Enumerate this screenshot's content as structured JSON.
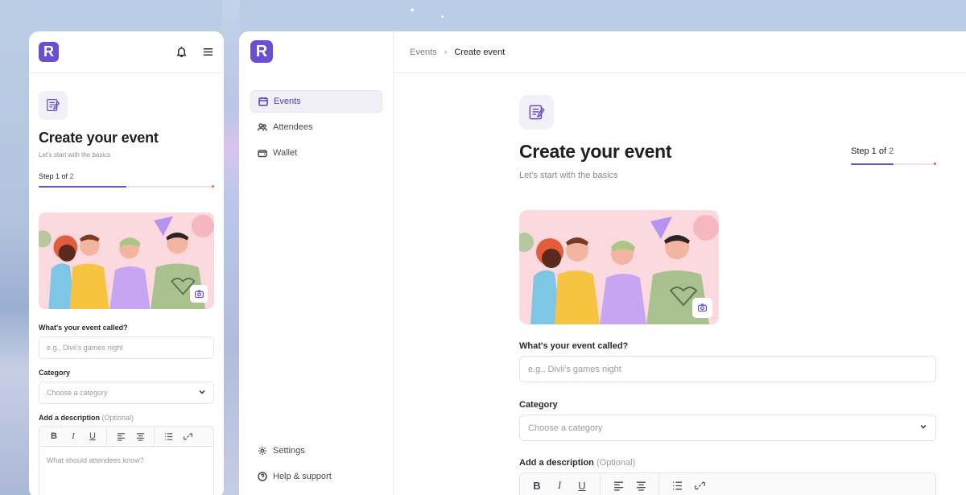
{
  "brand": {
    "logo_letter": "R",
    "accent": "#6b4fd1"
  },
  "mobile": {
    "header_icons": [
      "bell-icon",
      "menu-icon"
    ],
    "title": "Create your event",
    "subtitle": "Let's start with the basics",
    "step_prefix": "Step 1 of",
    "step_total": "2",
    "progress_fraction": 0.5,
    "event_name_label": "What's your event called?",
    "event_name_placeholder": "e.g., Divii's games night",
    "category_label": "Category",
    "category_placeholder": "Choose a category",
    "description_label": "Add a description",
    "description_optional": "(Optional)",
    "description_placeholder": "What should attendees know?"
  },
  "sidebar": {
    "items": [
      {
        "label": "Events",
        "icon": "calendar-icon",
        "active": true
      },
      {
        "label": "Attendees",
        "icon": "users-icon",
        "active": false
      },
      {
        "label": "Wallet",
        "icon": "wallet-icon",
        "active": false
      }
    ],
    "bottom_items": [
      {
        "label": "Settings",
        "icon": "gear-icon"
      },
      {
        "label": "Help & support",
        "icon": "help-icon"
      }
    ]
  },
  "breadcrumb": {
    "parent": "Events",
    "separator": "›",
    "current": "Create event"
  },
  "desktop": {
    "title": "Create your event",
    "subtitle": "Let's start with the basics",
    "step_prefix": "Step 1 of",
    "step_total": "2",
    "progress_fraction": 0.5,
    "event_name_label": "What's your event called?",
    "event_name_placeholder": "e.g., Divii's games night",
    "category_label": "Category",
    "category_placeholder": "Choose a category",
    "description_label": "Add a description",
    "description_optional": "(Optional)"
  },
  "toolbar": {
    "buttons": [
      {
        "icon": "bold-icon",
        "glyph": "B"
      },
      {
        "icon": "italic-icon",
        "glyph": "I"
      },
      {
        "icon": "underline-icon",
        "glyph": "U"
      },
      {
        "icon": "align-left-icon",
        "glyph": ""
      },
      {
        "icon": "align-center-icon",
        "glyph": ""
      },
      {
        "icon": "list-icon",
        "glyph": ""
      },
      {
        "icon": "link-icon",
        "glyph": ""
      }
    ]
  }
}
